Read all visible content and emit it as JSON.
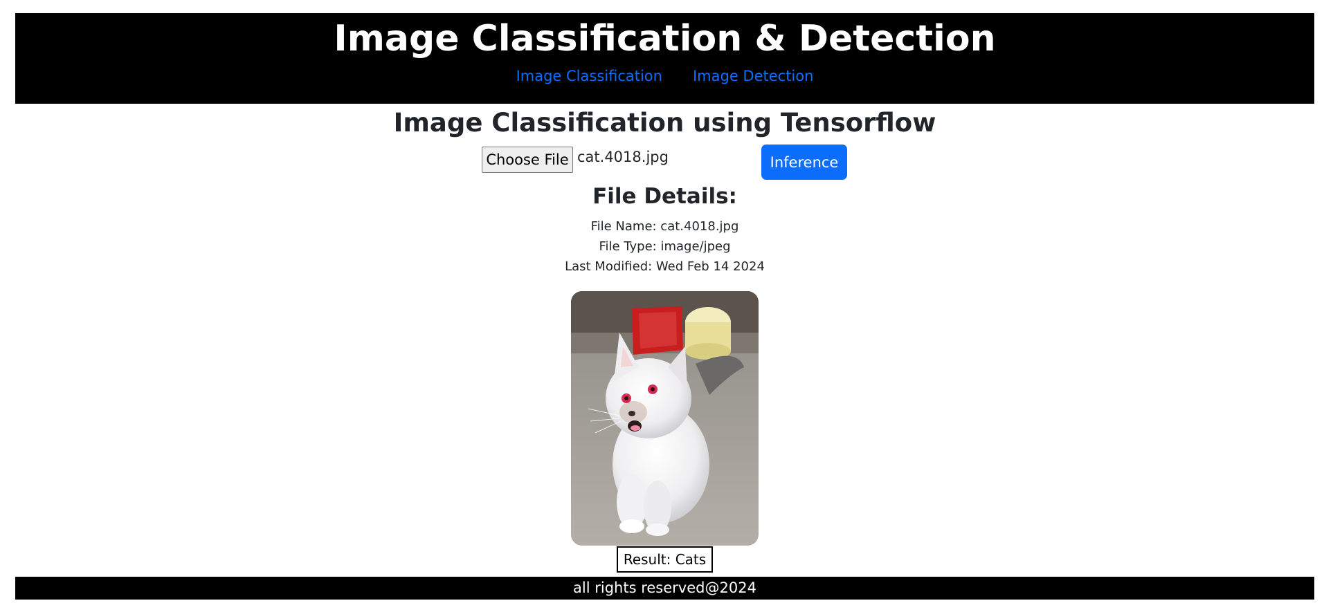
{
  "header": {
    "title": "Image Classification & Detection",
    "nav": [
      {
        "label": "Image Classification"
      },
      {
        "label": "Image Detection"
      }
    ]
  },
  "main": {
    "heading": "Image Classification using Tensorflow",
    "upload": {
      "button_label": "Choose File",
      "chosen_file": "cat.4018.jpg"
    },
    "inference_label": "Inference",
    "details": {
      "heading": "File Details:",
      "file_name": "File Name: cat.4018.jpg",
      "file_type": "File Type: image/jpeg",
      "last_modified": "Last Modified: Wed Feb 14 2024"
    },
    "result": "Result: Cats"
  },
  "footer": {
    "text": "all rights reserved@2024"
  },
  "colors": {
    "header_bg": "#000000",
    "link": "#0d6efd",
    "primary_button": "#0d6efd"
  }
}
